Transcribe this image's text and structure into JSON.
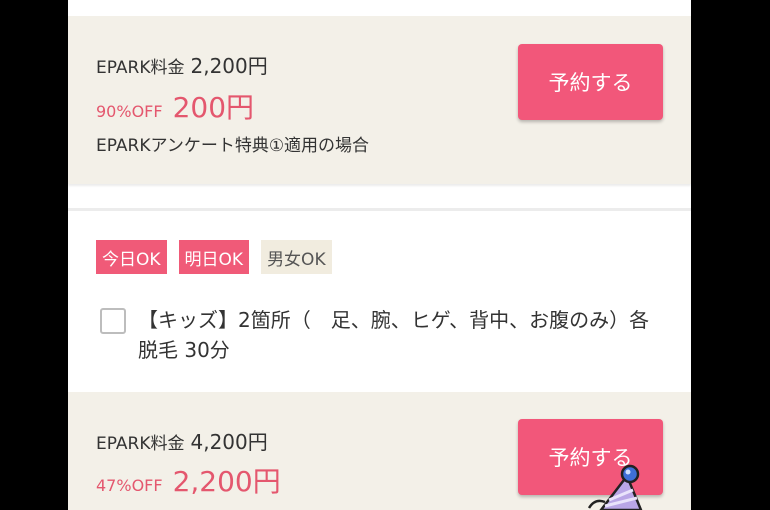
{
  "card1": {
    "epark_label": "EPARK料金",
    "epark_price": "2,200円",
    "discount_pct": "90%OFF",
    "sale_price": "200円",
    "note": "EPARKアンケート特典①適用の場合",
    "reserve_label": "予約する"
  },
  "tags": [
    "今日OK",
    "明日OK",
    "男女OK"
  ],
  "option": {
    "checked": false,
    "text": "【キッズ】2箇所（　足、腕、ヒゲ、背中、お腹のみ）各脱毛 30分"
  },
  "card2": {
    "epark_label": "EPARK料金",
    "epark_price": "4,200円",
    "discount_pct": "47%OFF",
    "sale_price": "2,200円",
    "reserve_label": "予約する"
  },
  "colors": {
    "accent": "#f2577a",
    "discount_text": "#e4576e",
    "card_bg": "#f3f0e8",
    "tag_beige": "#f1ecdf"
  },
  "icons": {
    "mascot": "party-hat-mascot-icon"
  }
}
